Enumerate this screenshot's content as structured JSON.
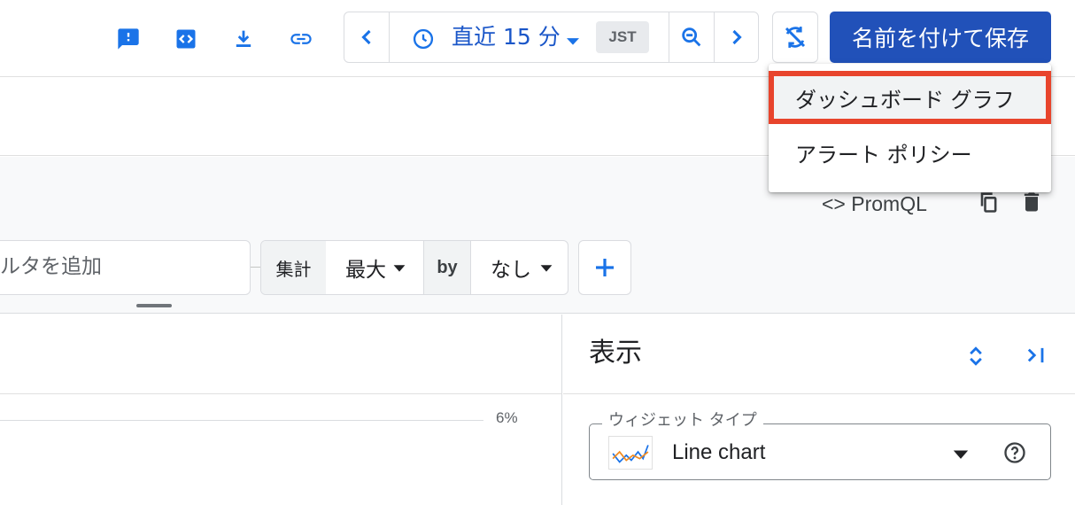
{
  "toolbar": {
    "time_range": "直近 15 分",
    "timezone": "JST",
    "save_label": "名前を付けて保存",
    "icons": [
      "feedback-icon",
      "code-icon",
      "download-icon",
      "link-icon",
      "chevron-left-icon",
      "clock-icon",
      "caret-down-icon",
      "zoom-out-icon",
      "chevron-right-icon",
      "sync-off-icon"
    ]
  },
  "save_menu": {
    "items": [
      "ダッシュボード グラフ",
      "アラート ポリシー"
    ],
    "highlighted_index": 0
  },
  "query": {
    "promql_label": "PromQL",
    "filter_placeholder": "ルタを追加",
    "aggregation_label": "集計",
    "aggregation_value": "最大",
    "by_label": "by",
    "group_by_value": "なし",
    "add_label": "+"
  },
  "chart": {
    "tick_label": "6%"
  },
  "display_panel": {
    "title": "表示",
    "widget_type_label": "ウィジェット タイプ",
    "widget_type_value": "Line chart"
  },
  "colors": {
    "accent": "#1a73e8",
    "primary_button": "#2151b9",
    "highlight_border": "#e8442c"
  }
}
